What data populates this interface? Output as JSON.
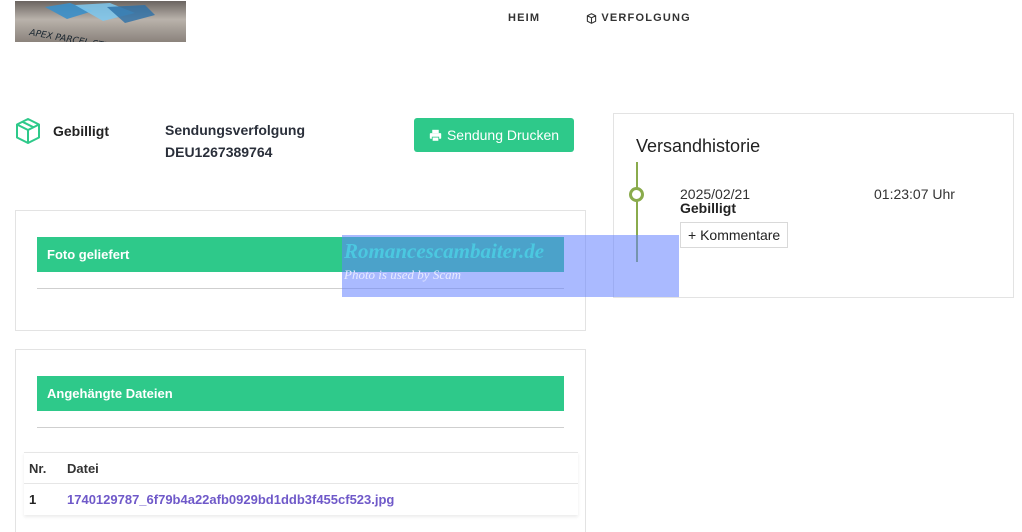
{
  "header": {
    "logo_text": "APEX PARCEL STEP",
    "nav": [
      {
        "label": "HEIM",
        "icon": null
      },
      {
        "label": "VERFOLGUNG",
        "icon": "cube-icon"
      }
    ]
  },
  "shipment": {
    "status": "Gebilligt",
    "tracking_title": "Sendungsverfolgung",
    "tracking_number": "DEU1267389764",
    "print_label": "Sendung Drucken"
  },
  "photo_section": {
    "title": "Foto geliefert"
  },
  "files_section": {
    "title": "Angehängte Dateien",
    "columns": [
      "Nr.",
      "Datei"
    ],
    "rows": [
      {
        "nr": "1",
        "file": "1740129787_6f79b4a22afb0929bd1ddb3f455cf523.jpg"
      }
    ]
  },
  "history": {
    "title": "Versandhistorie",
    "events": [
      {
        "date": "2025/02/21",
        "time": "01:23:07 Uhr",
        "status": "Gebilligt",
        "comment_label": "+ Kommentare"
      }
    ]
  },
  "watermark": {
    "title": "Romancescambaiter.de",
    "subtitle": "Photo is used by Scam"
  },
  "colors": {
    "accent_green": "#2ec98a",
    "timeline_green": "#8aab4c",
    "link_purple": "#6f59c9",
    "watermark_blue": "#6482ff"
  }
}
